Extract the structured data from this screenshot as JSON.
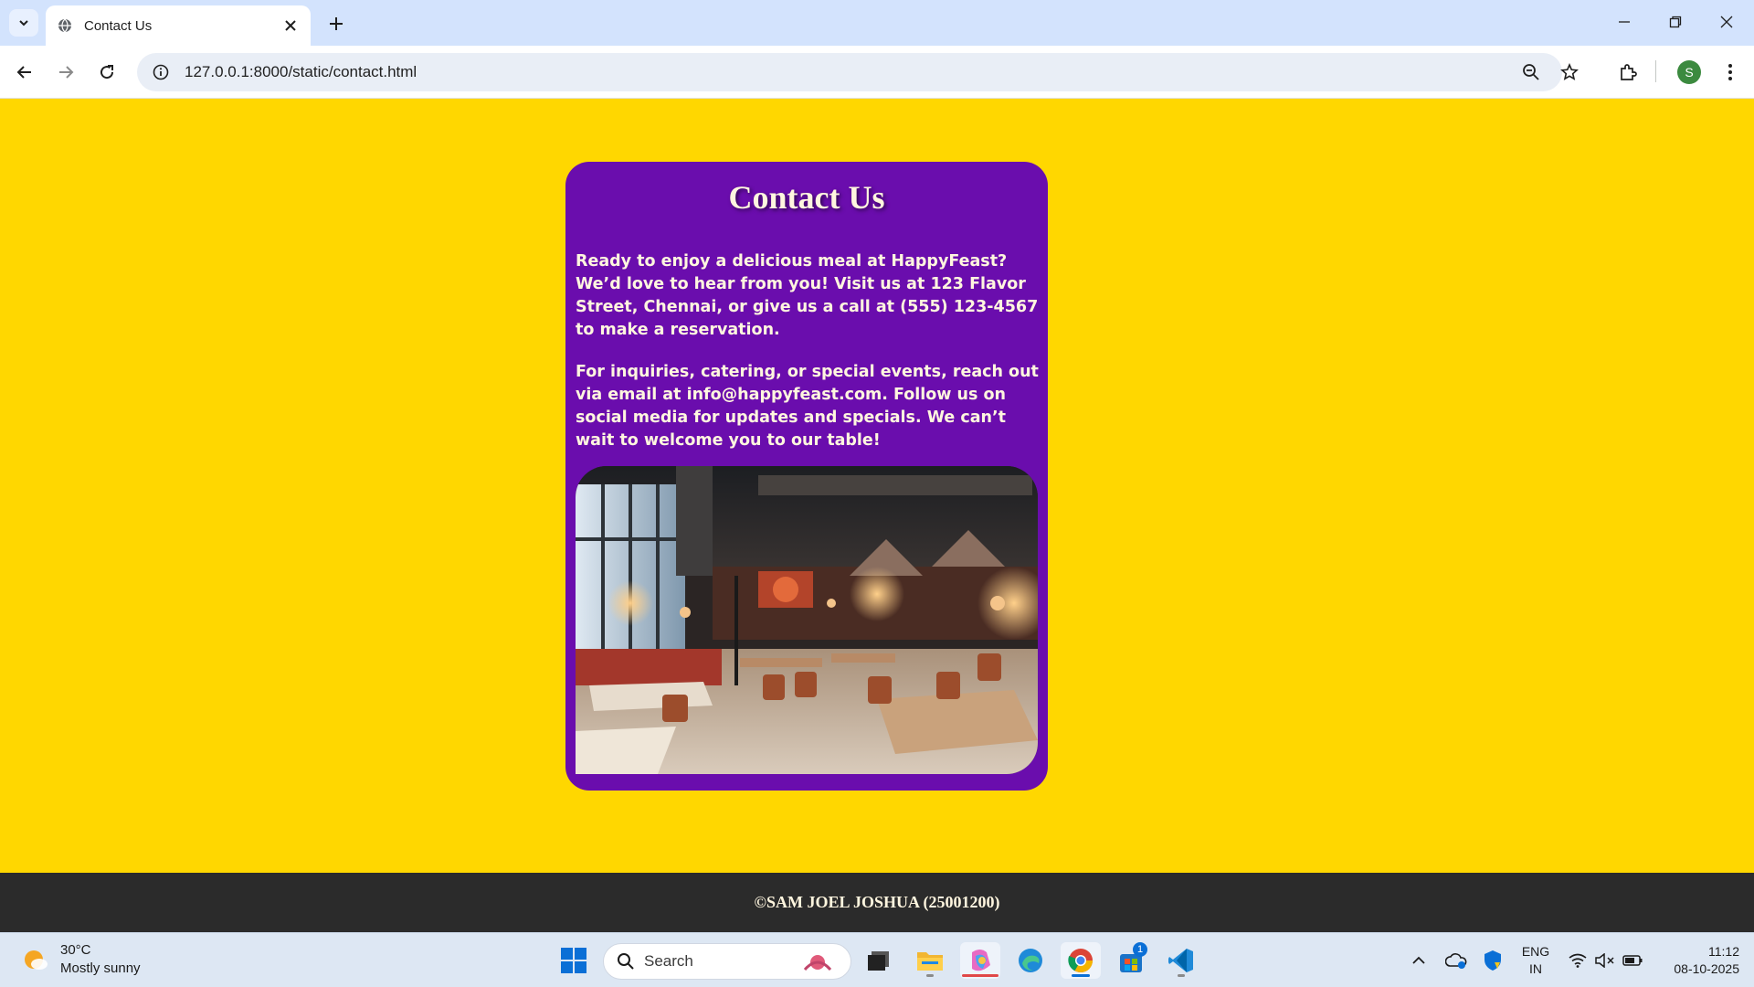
{
  "browser": {
    "tab_title": "Contact Us",
    "url": "127.0.0.1:8000/static/contact.html",
    "profile_initial": "S"
  },
  "page": {
    "heading": "Contact Us",
    "paragraph_1": "Ready to enjoy a delicious meal at HappyFeast? We’d love to hear from you! Visit us at 123 Flavor Street, Chennai, or give us a call at (555) 123-4567 to make a reservation.",
    "paragraph_2": "For inquiries, catering, or special events, reach out via email at info@happyfeast.com. Follow us on social media for updates and specials. We can’t wait to welcome you to our table!",
    "footer": "©SAM JOEL JOSHUA (25001200)"
  },
  "colors": {
    "page_background": "#ffd700",
    "card_background": "#6a0dad",
    "footer_background": "#2b2b2b",
    "text_cream": "#fff6df"
  },
  "taskbar": {
    "weather_temp": "30°C",
    "weather_desc": "Mostly sunny",
    "search_placeholder": "Search",
    "store_badge": "1",
    "lang_line1": "ENG",
    "lang_line2": "IN",
    "time": "11:12",
    "date": "08-10-2025"
  }
}
